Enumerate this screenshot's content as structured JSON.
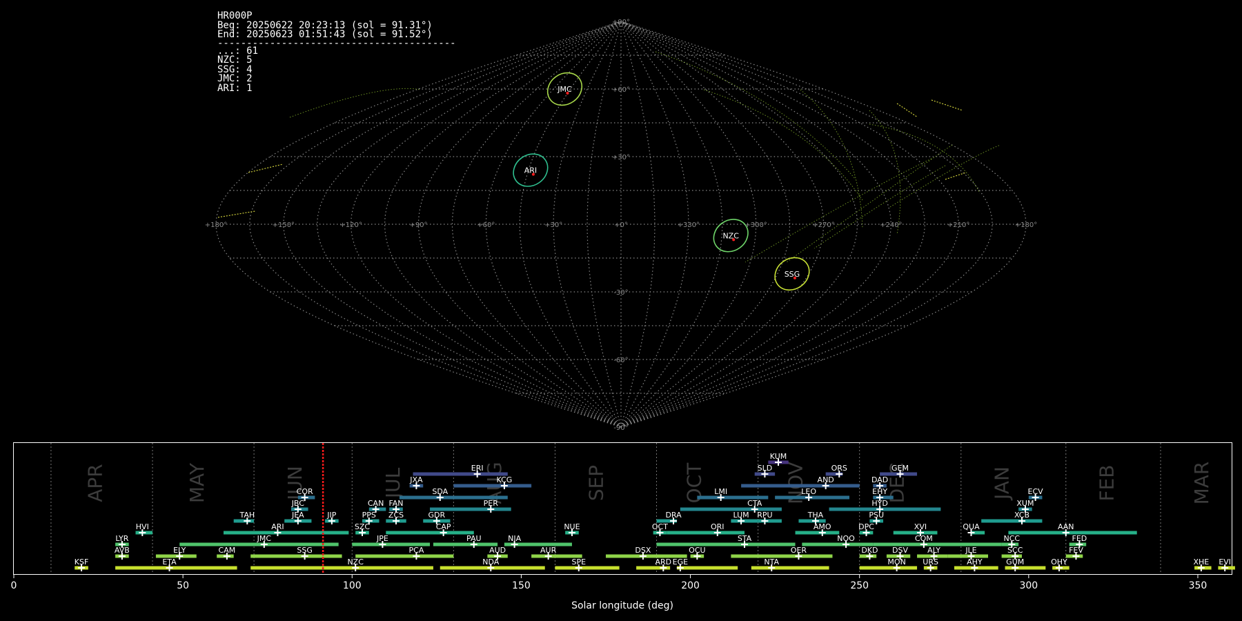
{
  "header": {
    "station": "HR000P",
    "begin": "Beg: 20250622 20:23:13 (sol = 91.31°)",
    "end": "End: 20250623 01:51:43 (sol = 91.52°)",
    "separator": "-----------------------------------------",
    "counts": [
      {
        "label": "...: 61"
      },
      {
        "label": "NZC: 5"
      },
      {
        "label": "SSG: 4"
      },
      {
        "label": "JMC: 2"
      },
      {
        "label": "ARI: 1"
      }
    ]
  },
  "chart_data": [
    {
      "type": "scatter",
      "projection": "sinusoidal",
      "grid": true,
      "lat_labels": [
        "+90°",
        "+60°",
        "+30°",
        "-30°",
        "-60°",
        "-90°"
      ],
      "lon_labels": [
        "+180°",
        "+150°",
        "+120°",
        "+90°",
        "+60°",
        "+30°",
        "+0°",
        "+330°",
        "+300°",
        "+270°",
        "+240°",
        "+210°",
        "+180°"
      ],
      "radiants": [
        {
          "name": "JMC",
          "lon": 50,
          "lat": 60,
          "color": "#a8d84a"
        },
        {
          "name": "ARI",
          "lon": 44,
          "lat": 24,
          "color": "#2fbf8f"
        },
        {
          "name": "NZC",
          "lon": 311,
          "lat": -5,
          "color": "#6fd66a"
        },
        {
          "name": "SSG",
          "lon": 278,
          "lat": -22,
          "color": "#c9e234"
        }
      ]
    },
    {
      "type": "bar",
      "xlabel": "Solar longitude (deg)",
      "xlim": [
        0,
        360
      ],
      "xticks": [
        0,
        50,
        100,
        150,
        200,
        250,
        300,
        350
      ],
      "current_sol": 91.4,
      "months": [
        {
          "name": "APR",
          "sol": 24
        },
        {
          "name": "MAY",
          "sol": 54
        },
        {
          "name": "JUN",
          "sol": 83
        },
        {
          "name": "JUL",
          "sol": 112
        },
        {
          "name": "AUG",
          "sol": 142
        },
        {
          "name": "SEP",
          "sol": 172
        },
        {
          "name": "OCT",
          "sol": 201
        },
        {
          "name": "NOV",
          "sol": 231
        },
        {
          "name": "DEC",
          "sol": 261
        },
        {
          "name": "JAN",
          "sol": 292
        },
        {
          "name": "FEB",
          "sol": 323
        },
        {
          "name": "MAR",
          "sol": 351
        }
      ],
      "month_boundaries": [
        11,
        41,
        71,
        100,
        130,
        160,
        190,
        220,
        250,
        280,
        311,
        339
      ],
      "showers": [
        {
          "code": "KSF",
          "start": 18,
          "end": 22,
          "peak": 20,
          "row": 0
        },
        {
          "code": "ETA",
          "start": 30,
          "end": 66,
          "peak": 46,
          "row": 0
        },
        {
          "code": "NZC",
          "start": 70,
          "end": 124,
          "peak": 101,
          "row": 0
        },
        {
          "code": "NDA",
          "start": 126,
          "end": 157,
          "peak": 141,
          "row": 0
        },
        {
          "code": "SPE",
          "start": 160,
          "end": 179,
          "peak": 167,
          "row": 0
        },
        {
          "code": "ARD",
          "start": 184,
          "end": 194,
          "peak": 192,
          "row": 0
        },
        {
          "code": "EGE",
          "start": 196,
          "end": 214,
          "peak": 197,
          "row": 0
        },
        {
          "code": "NTA",
          "start": 218,
          "end": 241,
          "peak": 224,
          "row": 0
        },
        {
          "code": "MON",
          "start": 250,
          "end": 267,
          "peak": 261,
          "row": 0
        },
        {
          "code": "URS",
          "start": 269,
          "end": 273,
          "peak": 271,
          "row": 0
        },
        {
          "code": "AHY",
          "start": 278,
          "end": 291,
          "peak": 284,
          "row": 0
        },
        {
          "code": "GUM",
          "start": 293,
          "end": 305,
          "peak": 296,
          "row": 0
        },
        {
          "code": "OHY",
          "start": 307,
          "end": 312,
          "peak": 309,
          "row": 0
        },
        {
          "code": "XHE",
          "start": 349,
          "end": 354,
          "peak": 351,
          "row": 0
        },
        {
          "code": "EVI",
          "start": 356,
          "end": 361,
          "peak": 358,
          "row": 0
        },
        {
          "code": "AVB",
          "start": 30,
          "end": 34,
          "peak": 32,
          "row": 1
        },
        {
          "code": "ELY",
          "start": 42,
          "end": 54,
          "peak": 49,
          "row": 1
        },
        {
          "code": "CAM",
          "start": 60,
          "end": 65,
          "peak": 63,
          "row": 1
        },
        {
          "code": "SSG",
          "start": 70,
          "end": 97,
          "peak": 86,
          "row": 1
        },
        {
          "code": "PCA",
          "start": 101,
          "end": 130,
          "peak": 119,
          "row": 1
        },
        {
          "code": "AUD",
          "start": 140,
          "end": 146,
          "peak": 143,
          "row": 1
        },
        {
          "code": "AUR",
          "start": 153,
          "end": 168,
          "peak": 158,
          "row": 1
        },
        {
          "code": "DSX",
          "start": 175,
          "end": 199,
          "peak": 186,
          "row": 1
        },
        {
          "code": "OCU",
          "start": 200,
          "end": 204,
          "peak": 202,
          "row": 1
        },
        {
          "code": "OER",
          "start": 212,
          "end": 242,
          "peak": 232,
          "row": 1
        },
        {
          "code": "DKD",
          "start": 250,
          "end": 255,
          "peak": 253,
          "row": 1
        },
        {
          "code": "DSV",
          "start": 258,
          "end": 265,
          "peak": 262,
          "row": 1
        },
        {
          "code": "ALY",
          "start": 267,
          "end": 276,
          "peak": 272,
          "row": 1
        },
        {
          "code": "JLE",
          "start": 276,
          "end": 288,
          "peak": 283,
          "row": 1
        },
        {
          "code": "SCC",
          "start": 292,
          "end": 298,
          "peak": 296,
          "row": 1
        },
        {
          "code": "FEV",
          "start": 311,
          "end": 316,
          "peak": 314,
          "row": 1
        },
        {
          "code": "LYR",
          "start": 30,
          "end": 34,
          "peak": 32,
          "row": 2
        },
        {
          "code": "JMC",
          "start": 49,
          "end": 96,
          "peak": 74,
          "row": 2
        },
        {
          "code": "JPE",
          "start": 100,
          "end": 123,
          "peak": 109,
          "row": 2
        },
        {
          "code": "PAU",
          "start": 124,
          "end": 143,
          "peak": 136,
          "row": 2
        },
        {
          "code": "NIA",
          "start": 145,
          "end": 165,
          "peak": 148,
          "row": 2
        },
        {
          "code": "STA",
          "start": 190,
          "end": 231,
          "peak": 216,
          "row": 2
        },
        {
          "code": "NOO",
          "start": 233,
          "end": 254,
          "peak": 246,
          "row": 2
        },
        {
          "code": "COM",
          "start": 254,
          "end": 292,
          "peak": 269,
          "row": 2
        },
        {
          "code": "NCC",
          "start": 292,
          "end": 297,
          "peak": 295,
          "row": 2
        },
        {
          "code": "FED",
          "start": 312,
          "end": 317,
          "peak": 315,
          "row": 2
        },
        {
          "code": "HVI",
          "start": 36,
          "end": 41,
          "peak": 38,
          "row": 3
        },
        {
          "code": "ARI",
          "start": 62,
          "end": 99,
          "peak": 78,
          "row": 3
        },
        {
          "code": "SZC",
          "start": 101,
          "end": 105,
          "peak": 103,
          "row": 3
        },
        {
          "code": "CAP",
          "start": 110,
          "end": 136,
          "peak": 127,
          "row": 3
        },
        {
          "code": "NUE",
          "start": 163,
          "end": 167,
          "peak": 165,
          "row": 3
        },
        {
          "code": "OCT",
          "start": 189,
          "end": 193,
          "peak": 191,
          "row": 3
        },
        {
          "code": "ORI",
          "start": 193,
          "end": 216,
          "peak": 208,
          "row": 3
        },
        {
          "code": "AMO",
          "start": 231,
          "end": 244,
          "peak": 239,
          "row": 3
        },
        {
          "code": "DPC",
          "start": 250,
          "end": 254,
          "peak": 252,
          "row": 3
        },
        {
          "code": "XVI",
          "start": 260,
          "end": 273,
          "peak": 268,
          "row": 3
        },
        {
          "code": "QUA",
          "start": 283,
          "end": 287,
          "peak": 283,
          "row": 3
        },
        {
          "code": "AAN",
          "start": 294,
          "end": 332,
          "peak": 311,
          "row": 3
        },
        {
          "code": "TAH",
          "start": 65,
          "end": 71,
          "peak": 69,
          "row": 4
        },
        {
          "code": "JEA",
          "start": 80,
          "end": 88,
          "peak": 84,
          "row": 4
        },
        {
          "code": "JIP",
          "start": 92,
          "end": 96,
          "peak": 94,
          "row": 4
        },
        {
          "code": "PPS",
          "start": 103,
          "end": 108,
          "peak": 105,
          "row": 4
        },
        {
          "code": "ZCS",
          "start": 110,
          "end": 116,
          "peak": 113,
          "row": 4
        },
        {
          "code": "GDR",
          "start": 121,
          "end": 129,
          "peak": 125,
          "row": 4
        },
        {
          "code": "DRA",
          "start": 190,
          "end": 196,
          "peak": 195,
          "row": 4
        },
        {
          "code": "LUM",
          "start": 212,
          "end": 220,
          "peak": 215,
          "row": 4
        },
        {
          "code": "RPU",
          "start": 220,
          "end": 227,
          "peak": 222,
          "row": 4
        },
        {
          "code": "THA",
          "start": 232,
          "end": 240,
          "peak": 237,
          "row": 4
        },
        {
          "code": "PSU",
          "start": 253,
          "end": 257,
          "peak": 255,
          "row": 4
        },
        {
          "code": "XCB",
          "start": 286,
          "end": 304,
          "peak": 298,
          "row": 4
        },
        {
          "code": "JBC",
          "start": 82,
          "end": 87,
          "peak": 84,
          "row": 5
        },
        {
          "code": "CAN",
          "start": 105,
          "end": 110,
          "peak": 107,
          "row": 5
        },
        {
          "code": "FAN",
          "start": 111,
          "end": 115,
          "peak": 113,
          "row": 5
        },
        {
          "code": "PER",
          "start": 123,
          "end": 147,
          "peak": 141,
          "row": 5
        },
        {
          "code": "CTA",
          "start": 197,
          "end": 227,
          "peak": 219,
          "row": 5
        },
        {
          "code": "HYD",
          "start": 241,
          "end": 274,
          "peak": 256,
          "row": 5
        },
        {
          "code": "XUM",
          "start": 297,
          "end": 301,
          "peak": 299,
          "row": 5
        },
        {
          "code": "COR",
          "start": 84,
          "end": 89,
          "peak": 86,
          "row": 6
        },
        {
          "code": "SDA",
          "start": 114,
          "end": 146,
          "peak": 126,
          "row": 6
        },
        {
          "code": "LMI",
          "start": 202,
          "end": 223,
          "peak": 209,
          "row": 6
        },
        {
          "code": "LEO",
          "start": 225,
          "end": 247,
          "peak": 235,
          "row": 6
        },
        {
          "code": "EHY",
          "start": 254,
          "end": 260,
          "peak": 256,
          "row": 6
        },
        {
          "code": "ECV",
          "start": 300,
          "end": 304,
          "peak": 302,
          "row": 6
        },
        {
          "code": "JXA",
          "start": 117,
          "end": 121,
          "peak": 119,
          "row": 7
        },
        {
          "code": "KCG",
          "start": 130,
          "end": 153,
          "peak": 145,
          "row": 7
        },
        {
          "code": "AND",
          "start": 215,
          "end": 250,
          "peak": 240,
          "row": 7
        },
        {
          "code": "DAD",
          "start": 254,
          "end": 258,
          "peak": 256,
          "row": 7
        },
        {
          "code": "ERI",
          "start": 118,
          "end": 146,
          "peak": 137,
          "row": 8
        },
        {
          "code": "SLD",
          "start": 219,
          "end": 225,
          "peak": 222,
          "row": 8
        },
        {
          "code": "ORS",
          "start": 240,
          "end": 245,
          "peak": 244,
          "row": 8
        },
        {
          "code": "GEM",
          "start": 256,
          "end": 267,
          "peak": 262,
          "row": 8
        },
        {
          "code": "KUM",
          "start": 223,
          "end": 229,
          "peak": 226,
          "row": 9
        }
      ]
    }
  ]
}
